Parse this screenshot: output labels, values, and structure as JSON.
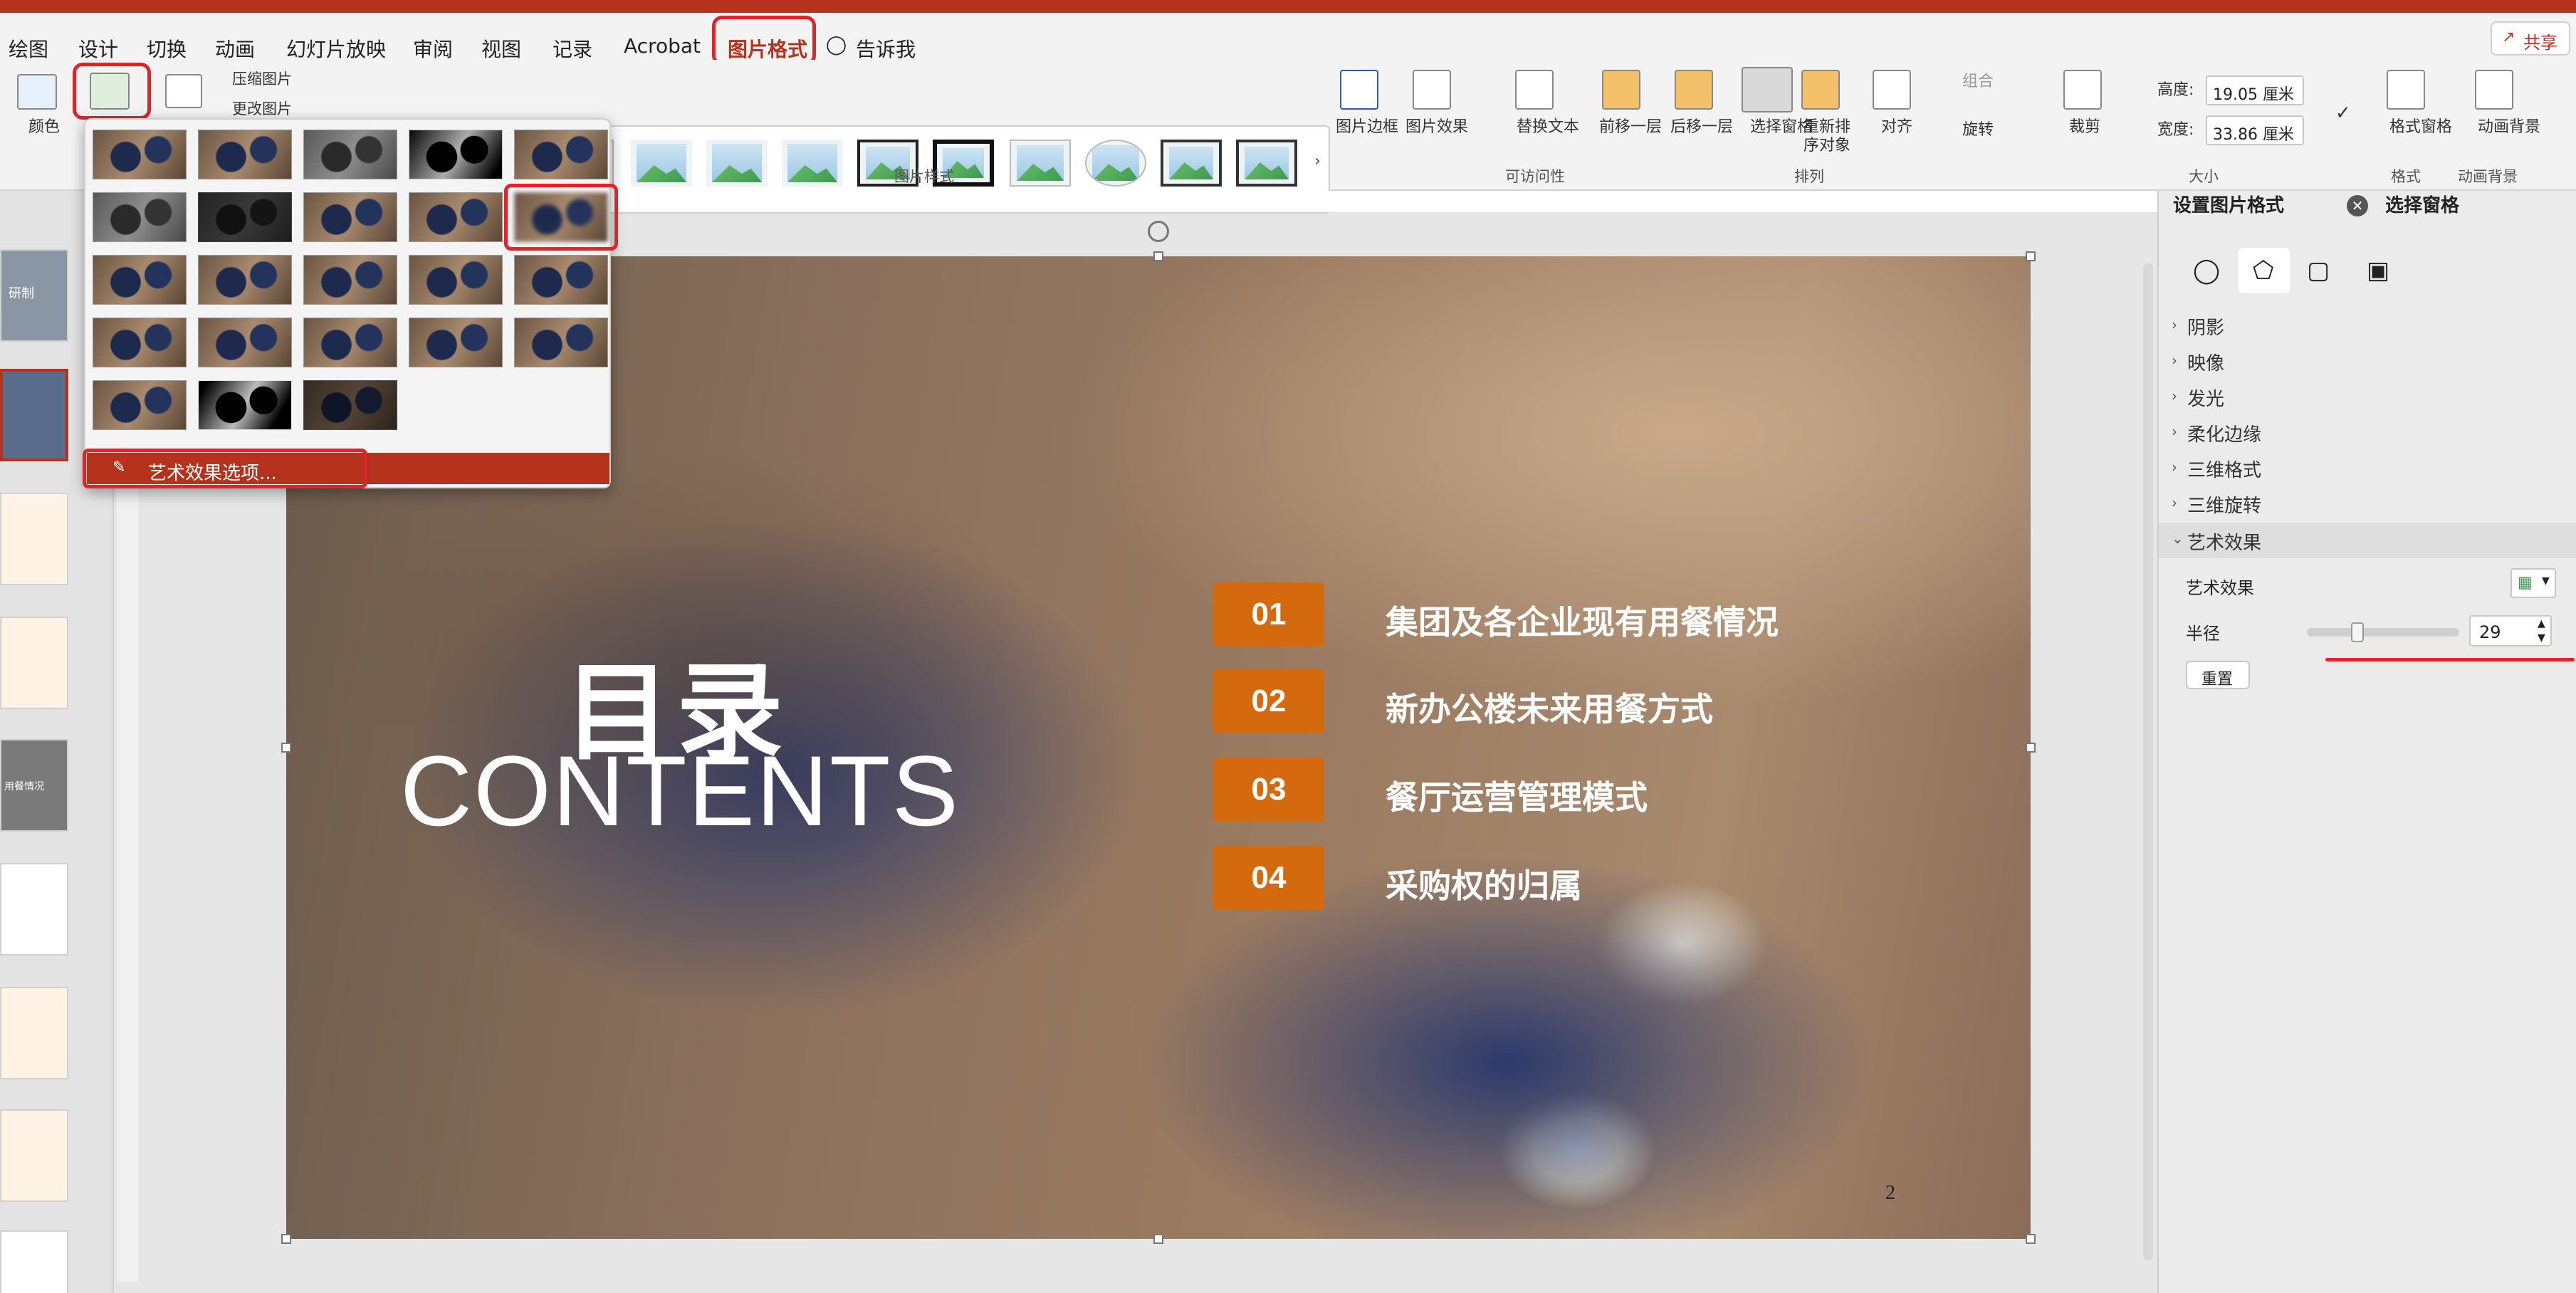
{
  "tabs": [
    "绘图",
    "设计",
    "切换",
    "动画",
    "幻灯片放映",
    "审阅",
    "视图",
    "记录",
    "Acrobat",
    "图片格式"
  ],
  "tell_me": "告诉我",
  "share": "共享",
  "ribbon": {
    "color": "颜色",
    "compress": "压缩图片",
    "change_picture": "更改图片",
    "picture_styles": "图片样式",
    "picture_border": "图片边框",
    "picture_effects": "图片效果",
    "alt_text": "替换文本",
    "accessibility": "可访问性",
    "bring_forward": "前移一层",
    "send_backward": "后移一层",
    "selection_pane": "选择窗格",
    "reorder": "重新排序对象",
    "align": "对齐",
    "group": "组合",
    "rotate": "旋转",
    "arrange": "排列",
    "crop": "裁剪",
    "height_label": "高度:",
    "height_value": "19.05 厘米",
    "width_label": "宽度:",
    "width_value": "33.86 厘米",
    "size": "大小",
    "format_pane": "格式窗格",
    "format": "格式",
    "animate_bg": "动画背景",
    "animate_bg_group": "动画背景"
  },
  "dropdown": {
    "option": "艺术效果选项..."
  },
  "slide": {
    "title": "目录",
    "subtitle": "CONTENTS",
    "items": [
      {
        "num": "01",
        "text": "集团及各企业现有用餐情况"
      },
      {
        "num": "02",
        "text": "新办公楼未来用餐方式"
      },
      {
        "num": "03",
        "text": "餐厅运营管理模式"
      },
      {
        "num": "04",
        "text": "采购权的归属"
      }
    ],
    "page": "2"
  },
  "thumbs": {
    "t1": "研制",
    "t5": "用餐情况"
  },
  "panel": {
    "tab1": "设置图片格式",
    "tab2": "选择窗格",
    "sections": [
      "阴影",
      "映像",
      "发光",
      "柔化边缘",
      "三维格式",
      "三维旋转",
      "艺术效果"
    ],
    "art_effect_label": "艺术效果",
    "radius_label": "半径",
    "radius_value": "29",
    "reset": "重置"
  },
  "colors": {
    "accent": "#b7321c",
    "orange": "#d4690e",
    "highlight": "#e0242a"
  },
  "icons": [
    "picture-icon",
    "artistic-effects-icon",
    "compress-icon",
    "lightbulb-icon",
    "share-icon",
    "fill-icon",
    "pentagon-icon",
    "size-icon",
    "image-icon",
    "close-icon",
    "up-arrow-icon",
    "down-arrow-icon"
  ]
}
